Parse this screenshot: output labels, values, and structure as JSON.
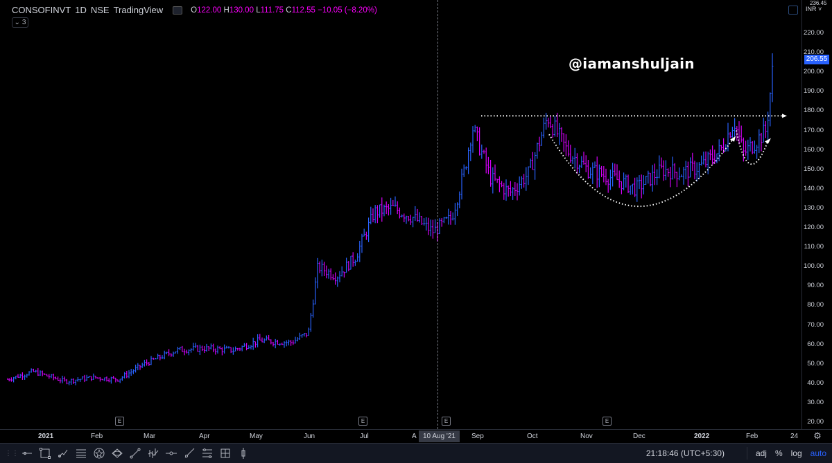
{
  "legend": {
    "symbol": "CONSOFINVT",
    "interval": "1D",
    "exchange": "NSE",
    "source": "TradingView",
    "o_label": "O",
    "o_value": "122.00",
    "h_label": "H",
    "h_value": "130.00",
    "l_label": "L",
    "l_value": "111.75",
    "c_label": "C",
    "c_value": "112.55",
    "change": "−10.05 (−8.20%)",
    "collapse_count": "3"
  },
  "watermark": "@iamanshuljain",
  "price_axis": {
    "currency": "INR",
    "top_value": "236.45",
    "current_price": "206.55",
    "current_price_value": 206.55,
    "ticks": [
      "220.00",
      "210.00",
      "200.00",
      "190.00",
      "180.00",
      "170.00",
      "160.00",
      "150.00",
      "140.00",
      "130.00",
      "120.00",
      "110.00",
      "100.00",
      "90.00",
      "80.00",
      "70.00",
      "60.00",
      "50.00",
      "40.00",
      "30.00",
      "20.00"
    ]
  },
  "time_axis": {
    "labels": [
      {
        "text": "2021",
        "bold": true
      },
      {
        "text": "Feb",
        "bold": false
      },
      {
        "text": "Mar",
        "bold": false
      },
      {
        "text": "Apr",
        "bold": false
      },
      {
        "text": "May",
        "bold": false
      },
      {
        "text": "Jun",
        "bold": false
      },
      {
        "text": "Jul",
        "bold": false
      },
      {
        "text": "A",
        "bold": false
      },
      {
        "text": "Sep",
        "bold": false
      },
      {
        "text": "Oct",
        "bold": false
      },
      {
        "text": "Nov",
        "bold": false
      },
      {
        "text": "Dec",
        "bold": false
      },
      {
        "text": "2022",
        "bold": true
      },
      {
        "text": "Feb",
        "bold": false
      },
      {
        "text": "24",
        "bold": false
      }
    ],
    "crosshair_date": "10 Aug '21"
  },
  "earnings_marker_label": "E",
  "toolbar": {
    "clock": "21:18:46 (UTC+5:30)",
    "adj": "adj",
    "percent": "%",
    "log": "log",
    "auto": "auto"
  },
  "colors": {
    "up": "#2962ff",
    "down": "#d500f9",
    "background": "#000000",
    "accent": "#2962ff"
  },
  "chart_data": {
    "type": "ohlc-bar",
    "resistance_level": 177.5,
    "ylim": [
      20,
      236.45
    ],
    "series": [
      {
        "date": "2021-01-01",
        "close": 42
      },
      {
        "date": "2021-01-15",
        "close": 46
      },
      {
        "date": "2021-02-01",
        "close": 41
      },
      {
        "date": "2021-02-15",
        "close": 43
      },
      {
        "date": "2021-03-01",
        "close": 42
      },
      {
        "date": "2021-03-15",
        "close": 50
      },
      {
        "date": "2021-04-01",
        "close": 57
      },
      {
        "date": "2021-04-15",
        "close": 58
      },
      {
        "date": "2021-05-01",
        "close": 57
      },
      {
        "date": "2021-05-15",
        "close": 62
      },
      {
        "date": "2021-06-01",
        "close": 61
      },
      {
        "date": "2021-06-10",
        "close": 66
      },
      {
        "date": "2021-06-15",
        "close": 100
      },
      {
        "date": "2021-06-25",
        "close": 95
      },
      {
        "date": "2021-07-05",
        "close": 105
      },
      {
        "date": "2021-07-15",
        "close": 128
      },
      {
        "date": "2021-07-25",
        "close": 130
      },
      {
        "date": "2021-08-05",
        "close": 125
      },
      {
        "date": "2021-08-15",
        "close": 118
      },
      {
        "date": "2021-08-25",
        "close": 125
      },
      {
        "date": "2021-09-01",
        "close": 150
      },
      {
        "date": "2021-09-05",
        "close": 172
      },
      {
        "date": "2021-09-15",
        "close": 145
      },
      {
        "date": "2021-09-25",
        "close": 138
      },
      {
        "date": "2021-10-05",
        "close": 148
      },
      {
        "date": "2021-10-15",
        "close": 177
      },
      {
        "date": "2021-10-25",
        "close": 160
      },
      {
        "date": "2021-11-05",
        "close": 150
      },
      {
        "date": "2021-11-20",
        "close": 145
      },
      {
        "date": "2021-12-01",
        "close": 140
      },
      {
        "date": "2021-12-15",
        "close": 150
      },
      {
        "date": "2021-12-25",
        "close": 148
      },
      {
        "date": "2022-01-05",
        "close": 152
      },
      {
        "date": "2022-01-15",
        "close": 160
      },
      {
        "date": "2022-01-22",
        "close": 175
      },
      {
        "date": "2022-01-27",
        "close": 158
      },
      {
        "date": "2022-02-03",
        "close": 165
      },
      {
        "date": "2022-02-08",
        "close": 170
      },
      {
        "date": "2022-02-12",
        "close": 206.55
      }
    ]
  }
}
